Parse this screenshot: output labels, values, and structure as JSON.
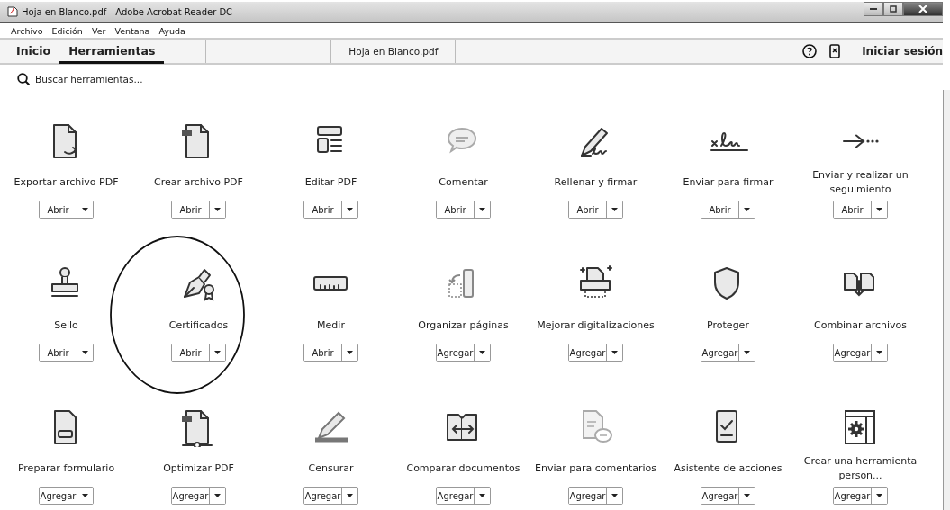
{
  "window": {
    "title": "Hoja en Blanco.pdf - Adobe Acrobat Reader DC"
  },
  "menu": [
    "Archivo",
    "Edición",
    "Ver",
    "Ventana",
    "Ayuda"
  ],
  "tabs": [
    {
      "label": "Inicio",
      "selected": false
    },
    {
      "label": "Herramientas",
      "selected": true
    }
  ],
  "document_tab": {
    "label": "Hoja en Blanco.pdf"
  },
  "sign_in": "Iniciar sesión",
  "search": {
    "placeholder": "Buscar herramientas..."
  },
  "tools": [
    {
      "label": "Exportar archivo PDF",
      "action": "Abrir",
      "highlighted": false
    },
    {
      "label": "Crear archivo PDF",
      "action": "Abrir",
      "highlighted": false
    },
    {
      "label": "Editar PDF",
      "action": "Abrir",
      "highlighted": false
    },
    {
      "label": "Comentar",
      "action": "Abrir",
      "highlighted": false
    },
    {
      "label": "Rellenar y firmar",
      "action": "Abrir",
      "highlighted": false
    },
    {
      "label": "Enviar para firmar",
      "action": "Abrir",
      "highlighted": false
    },
    {
      "label": "Enviar y realizar un seguimiento",
      "action": "Abrir",
      "highlighted": false
    },
    {
      "label": "Sello",
      "action": "Abrir",
      "highlighted": false
    },
    {
      "label": "Certificados",
      "action": "Abrir",
      "highlighted": true
    },
    {
      "label": "Medir",
      "action": "Abrir",
      "highlighted": false
    },
    {
      "label": "Organizar páginas",
      "action": "Agregar",
      "highlighted": false
    },
    {
      "label": "Mejorar digitalizaciones",
      "action": "Agregar",
      "highlighted": false
    },
    {
      "label": "Proteger",
      "action": "Agregar",
      "highlighted": false
    },
    {
      "label": "Combinar archivos",
      "action": "Agregar",
      "highlighted": false
    },
    {
      "label": "Preparar formulario",
      "action": "Agregar",
      "highlighted": false
    },
    {
      "label": "Optimizar PDF",
      "action": "Agregar",
      "highlighted": false
    },
    {
      "label": "Censurar",
      "action": "Agregar",
      "highlighted": false
    },
    {
      "label": "Comparar documentos",
      "action": "Agregar",
      "highlighted": false
    },
    {
      "label": "Enviar para comentarios",
      "action": "Agregar",
      "highlighted": false
    },
    {
      "label": "Asistente de acciones",
      "action": "Agregar",
      "highlighted": false
    },
    {
      "label": "Crear una herramienta person...",
      "action": "Agregar",
      "highlighted": false
    }
  ]
}
